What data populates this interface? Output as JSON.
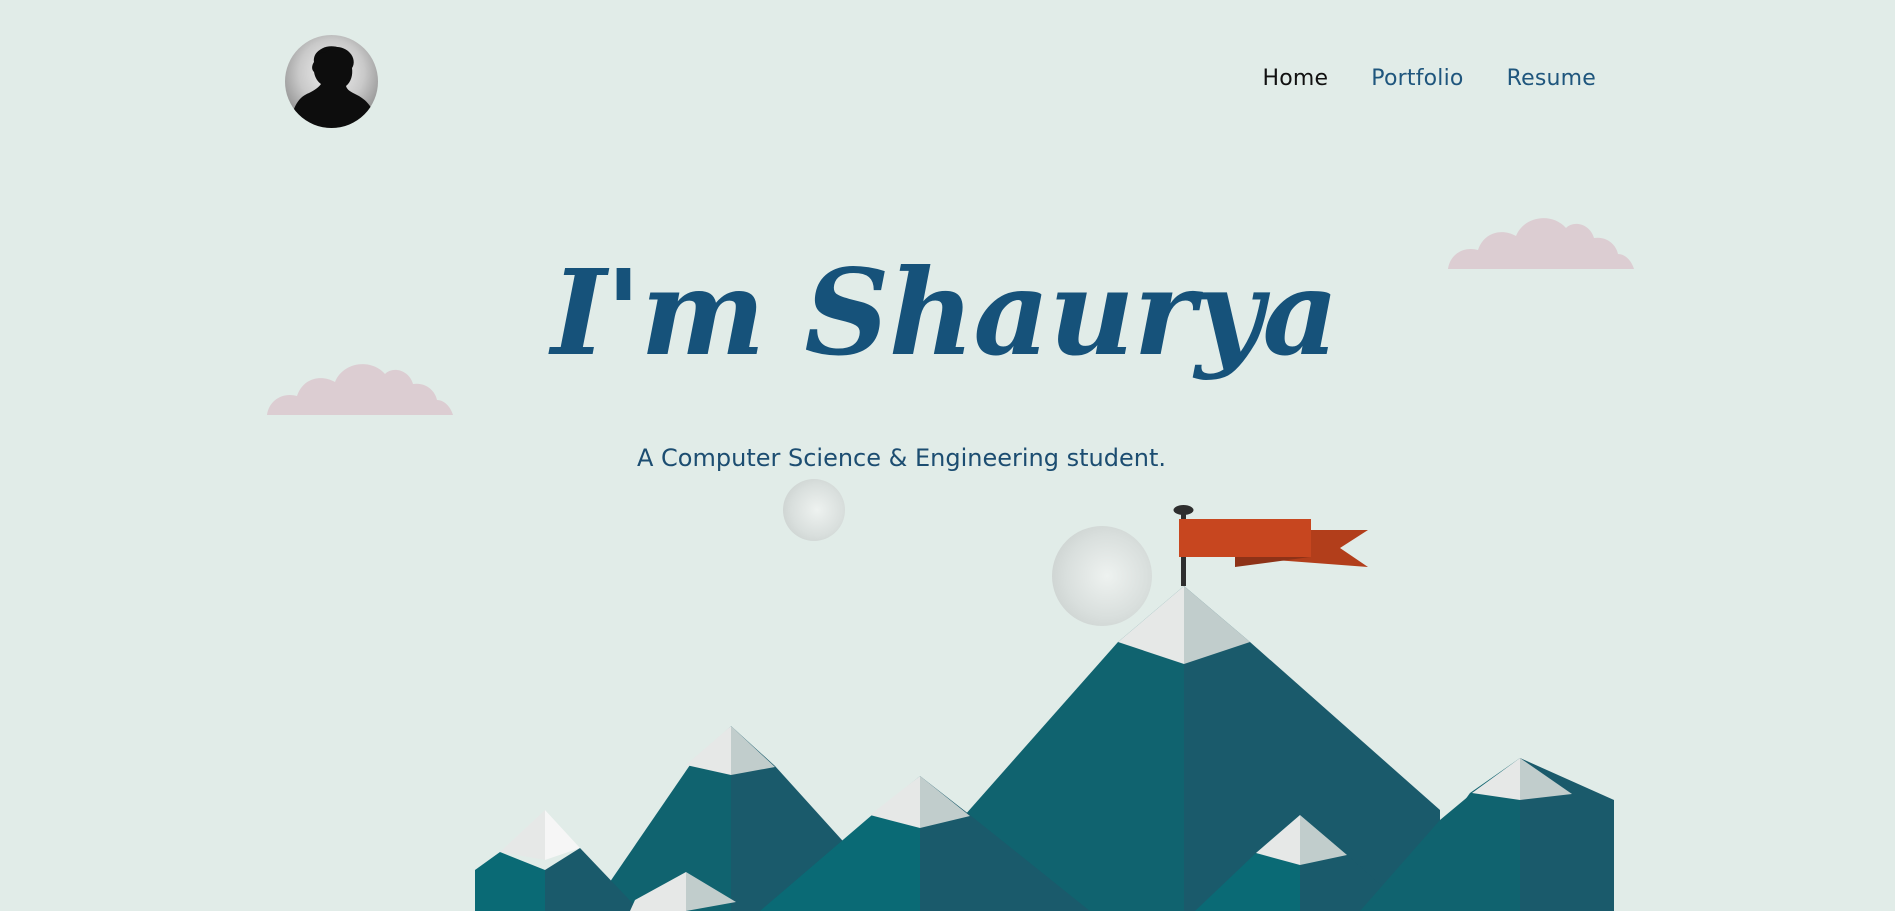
{
  "nav": {
    "items": [
      {
        "label": "Home",
        "active": true
      },
      {
        "label": "Portfolio",
        "active": false
      },
      {
        "label": "Resume",
        "active": false
      }
    ]
  },
  "hero": {
    "title": "I'm Shaurya",
    "subtitle": "A Computer Science & Engineering student."
  },
  "colors": {
    "background": "#e1ece8",
    "title": "#16527a",
    "nav_link": "#1f567d",
    "nav_active": "#111111",
    "flag": "#c7461f",
    "mountain_dark": "#1a5a6b",
    "mountain_mid": "#10636f",
    "cloud": "#dccdd2"
  },
  "icons": {
    "avatar": "person-silhouette-icon",
    "flag": "flag-icon"
  }
}
